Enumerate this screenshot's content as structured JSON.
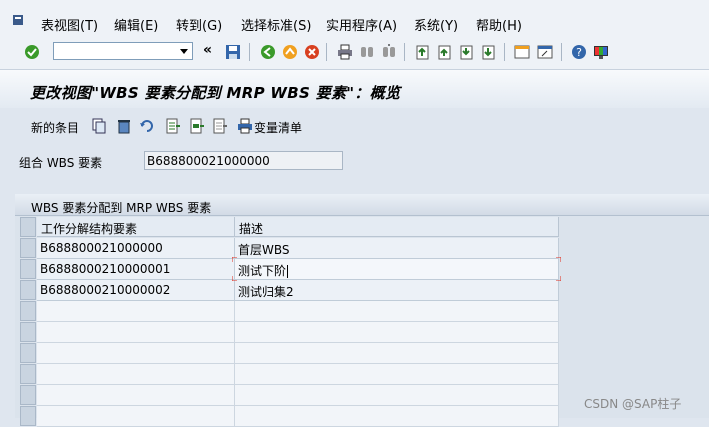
{
  "menu": [
    "表视图(T)",
    "编辑(E)",
    "转到(G)",
    "选择标准(S)",
    "实用程序(A)",
    "系统(Y)",
    "帮助(H)"
  ],
  "toolbar": {
    "command_field": "",
    "icons": [
      "enter-icon",
      "command-dropdown-icon",
      "back-double-arrow-icon",
      "save-icon",
      "back-icon",
      "exit-icon",
      "cancel-icon",
      "print-icon",
      "find-icon",
      "find-next-icon",
      "first-page-icon",
      "previous-page-icon",
      "next-page-icon",
      "last-page-icon",
      "create-session-icon",
      "shortcut-icon",
      "help-icon",
      "customize-layout-icon"
    ]
  },
  "title": "更改视图\"WBS 要素分配到 MRP WBS 要素\"：概览",
  "app_toolbar": {
    "new_entries": "新的条目",
    "variant_list": "变量清单"
  },
  "field": {
    "label": "组合 WBS 要素",
    "value": "B688800021000000"
  },
  "table": {
    "title": "WBS 要素分配到 MRP WBS 要素",
    "columns": [
      "工作分解结构要素",
      "描述"
    ],
    "rows": [
      [
        "B688800021000000",
        "首层WBS"
      ],
      [
        "B6888000210000001",
        "测试下阶"
      ],
      [
        "B6888000210000002",
        "测试归集2"
      ]
    ]
  },
  "watermark": "CSDN @SAP柱子",
  "colors": {
    "accent_green": "#3a9a2a",
    "accent_orange": "#f0a020",
    "accent_red": "#d84020",
    "edit_marker": "#e03020"
  }
}
